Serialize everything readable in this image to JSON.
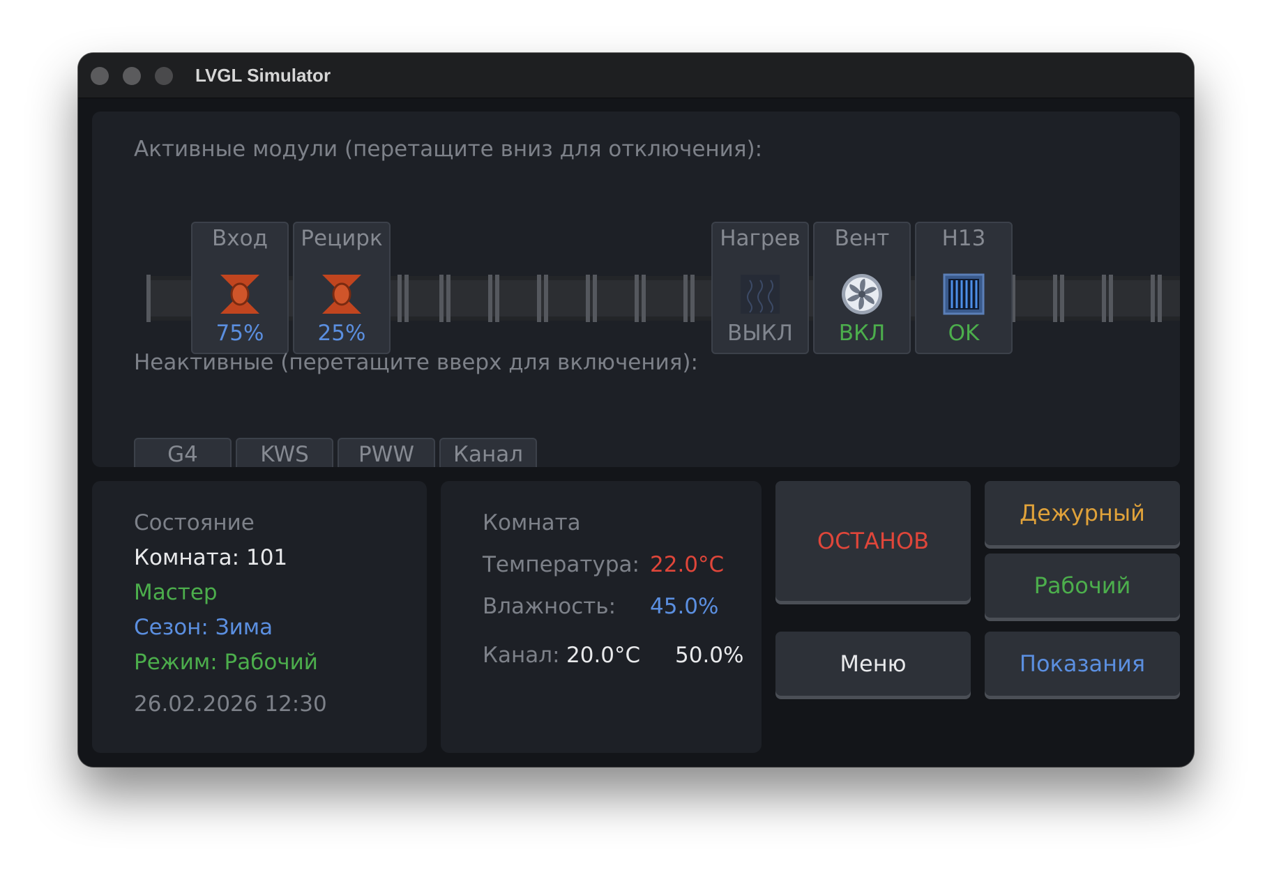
{
  "window": {
    "title": "LVGL Simulator"
  },
  "active_section": {
    "label": "Активные модули (перетащите вниз для отключения):",
    "modules": [
      {
        "name": "Вход",
        "value": "75%",
        "icon": "damper-icon",
        "color": "#5b8fe0"
      },
      {
        "name": "Рецирк",
        "value": "25%",
        "icon": "damper-icon",
        "color": "#5b8fe0"
      },
      {
        "name": "Нагрев",
        "value": "ВЫКЛ",
        "icon": "heater-icon",
        "color": "#80858e"
      },
      {
        "name": "Вент",
        "value": "ВКЛ",
        "icon": "fan-icon",
        "color": "#4cae4c"
      },
      {
        "name": "H13",
        "value": "OK",
        "icon": "filter-icon",
        "color": "#4cae4c"
      }
    ]
  },
  "inactive_section": {
    "label": "Неактивные (перетащите вверх для включения):",
    "modules": [
      {
        "name": "G4",
        "icon": "filter-icon"
      },
      {
        "name": "KWS",
        "icon": "coil-red-icon"
      },
      {
        "name": "PWW",
        "icon": "coil-blue-icon"
      },
      {
        "name": "Канал",
        "icon": "sensor-icon"
      }
    ]
  },
  "status": {
    "title": "Состояние",
    "room": "Комната: 101",
    "role": "Мастер",
    "season": "Сезон: Зима",
    "mode": "Режим: Рабочий",
    "datetime": "26.02.2026 12:30"
  },
  "room_panel": {
    "title": "Комната",
    "temp_label": "Температура:",
    "temp_value": "22.0°C",
    "hum_label": "Влажность:",
    "hum_value": "45.0%",
    "duct_label": "Канал:",
    "duct_temp": "20.0°C",
    "duct_hum": "50.0%"
  },
  "buttons": {
    "stop": "ОСТАНОВ",
    "standby": "Дежурный",
    "work": "Рабочий",
    "menu": "Меню",
    "readings": "Показания"
  },
  "colors": {
    "accent_blue": "#5b8fe0",
    "green": "#4cae4c",
    "red": "#e0463a",
    "orange": "#e0a23a",
    "grey_text": "#80858e"
  }
}
